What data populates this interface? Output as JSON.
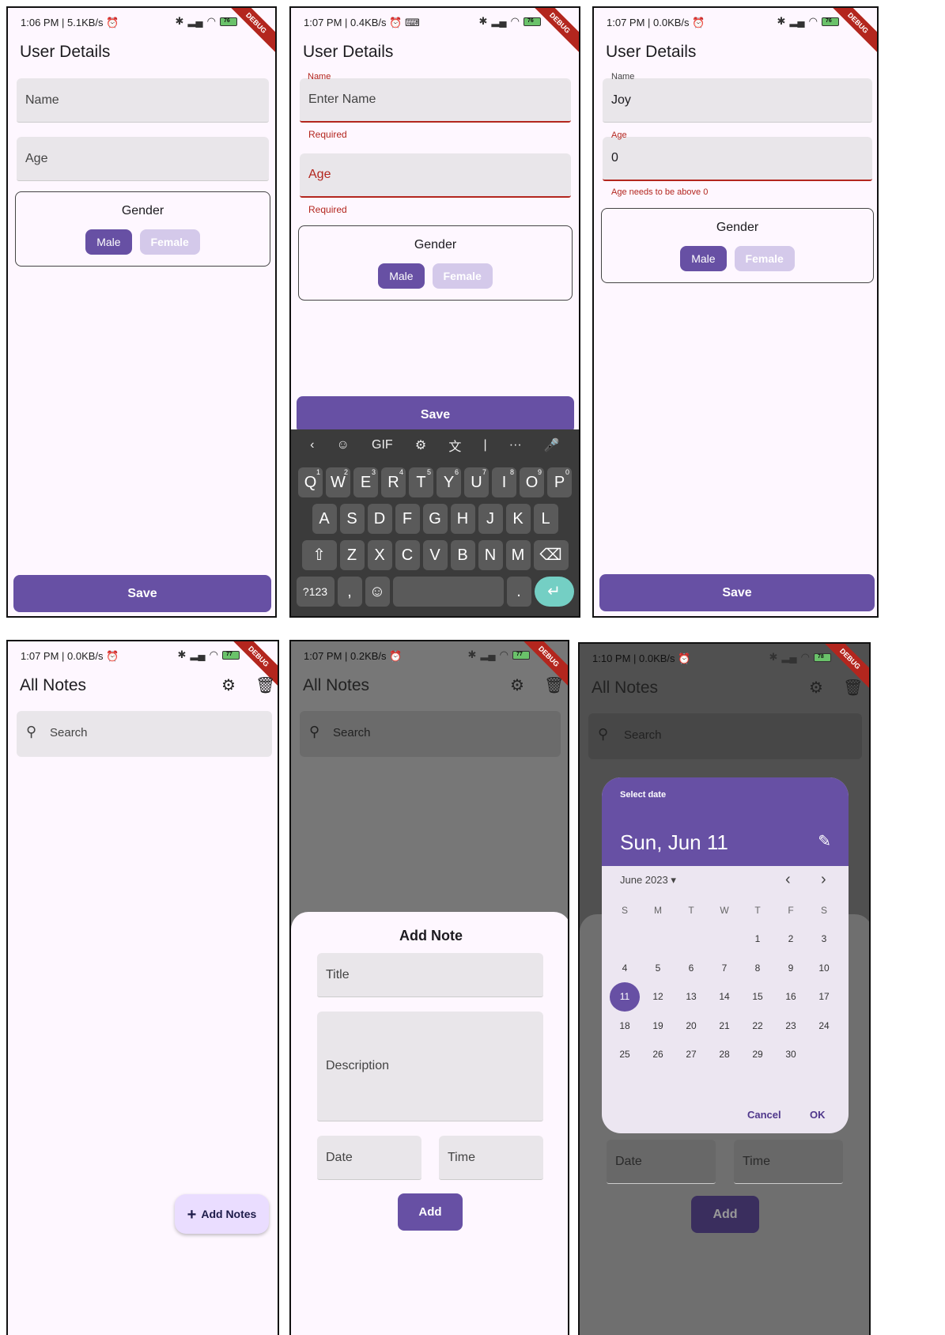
{
  "status": {
    "s1": "1:06 PM | 5.1KB/s ⏰",
    "s2": "1:07 PM | 0.4KB/s ⏰ ⌨",
    "s3": "1:07 PM | 0.0KB/s ⏰",
    "s4": "1:07 PM | 0.0KB/s ⏰",
    "s5": "1:07 PM | 0.2KB/s ⏰",
    "s6": "1:10 PM | 0.0KB/s ⏰",
    "battery1": "76",
    "battery2": "76",
    "battery3": "76",
    "battery4": "77",
    "battery5": "77",
    "battery6": "78",
    "ribbon": "DEBUG"
  },
  "user_details": {
    "title": "User Details",
    "name_placeholder": "Name",
    "age_placeholder": "Age",
    "name_label": "Name",
    "enter_name_hint": "Enter Name",
    "required": "Required",
    "name_value": "Joy",
    "age_label": "Age",
    "age_value": "0",
    "age_error": "Age needs to be above 0",
    "gender_label": "Gender",
    "male": "Male",
    "female": "Female",
    "save": "Save"
  },
  "keyboard": {
    "toolbar": [
      "‹",
      "☺",
      "GIF",
      "⚙",
      "文",
      "|",
      "···",
      "🎤"
    ],
    "row1": [
      "Q",
      "W",
      "E",
      "R",
      "T",
      "Y",
      "U",
      "I",
      "O",
      "P"
    ],
    "row1_sup": [
      "1",
      "2",
      "3",
      "4",
      "5",
      "6",
      "7",
      "8",
      "9",
      "0"
    ],
    "row2": [
      "A",
      "S",
      "D",
      "F",
      "G",
      "H",
      "J",
      "K",
      "L"
    ],
    "row3": [
      "⇧",
      "Z",
      "X",
      "C",
      "V",
      "B",
      "N",
      "M",
      "⌫"
    ],
    "row4": [
      "?123",
      ",",
      "☺",
      "",
      ".",
      "↵"
    ]
  },
  "notes": {
    "title": "All Notes",
    "search_placeholder": "Search",
    "fab": "Add Notes",
    "fab_icon": "+",
    "sheet_title": "Add Note",
    "title_ph": "Title",
    "desc_ph": "Description",
    "date_ph": "Date",
    "time_ph": "Time",
    "add": "Add"
  },
  "date_picker": {
    "header": "Select date",
    "selected": "Sun, Jun 11",
    "month": "June 2023",
    "weekdays": [
      "S",
      "M",
      "T",
      "W",
      "T",
      "F",
      "S"
    ],
    "days": [
      "",
      "",
      "",
      "",
      "1",
      "2",
      "3",
      "4",
      "5",
      "6",
      "7",
      "8",
      "9",
      "10",
      "11",
      "12",
      "13",
      "14",
      "15",
      "16",
      "17",
      "18",
      "19",
      "20",
      "21",
      "22",
      "23",
      "24",
      "25",
      "26",
      "27",
      "28",
      "29",
      "30",
      "",
      ""
    ],
    "selected_day": "11",
    "cancel": "Cancel",
    "ok": "OK"
  },
  "colors": {
    "primary": "#6750a4",
    "error": "#b3261e",
    "field": "#e9e6ea"
  }
}
